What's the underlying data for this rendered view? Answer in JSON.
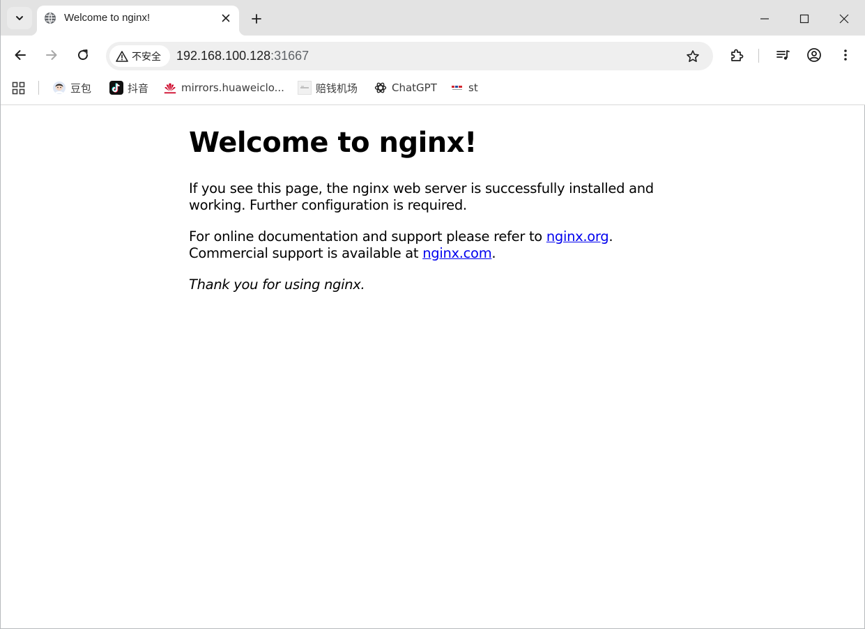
{
  "tab": {
    "title": "Welcome to nginx!"
  },
  "omnibox": {
    "security_label": "不安全",
    "url_host": "192.168.100.128",
    "url_port": ":31667"
  },
  "bookmarks": [
    {
      "label": "豆包",
      "icon": "doubao-icon"
    },
    {
      "label": "抖音",
      "icon": "douyin-icon"
    },
    {
      "label": "mirrors.huaweiclo...",
      "icon": "huawei-icon"
    },
    {
      "label": "赔钱机场",
      "icon": "airport-icon"
    },
    {
      "label": "ChatGPT",
      "icon": "chatgpt-icon"
    },
    {
      "label": "st",
      "icon": "st-icon"
    }
  ],
  "page": {
    "heading": "Welcome to nginx!",
    "p1": "If you see this page, the nginx web server is successfully installed and working. Further configuration is required.",
    "p2_text1": "For online documentation and support please refer to ",
    "p2_link1": "nginx.org",
    "p2_text2": ".",
    "p2_text3": "Commercial support is available at ",
    "p2_link2": "nginx.com",
    "p2_text4": ".",
    "p3": "Thank you for using nginx."
  },
  "colors": {
    "tabstrip_bg": "#e3e3e3",
    "omnibox_bg": "#efefef",
    "link": "#0000ee",
    "huawei_red": "#cf0a2c"
  }
}
